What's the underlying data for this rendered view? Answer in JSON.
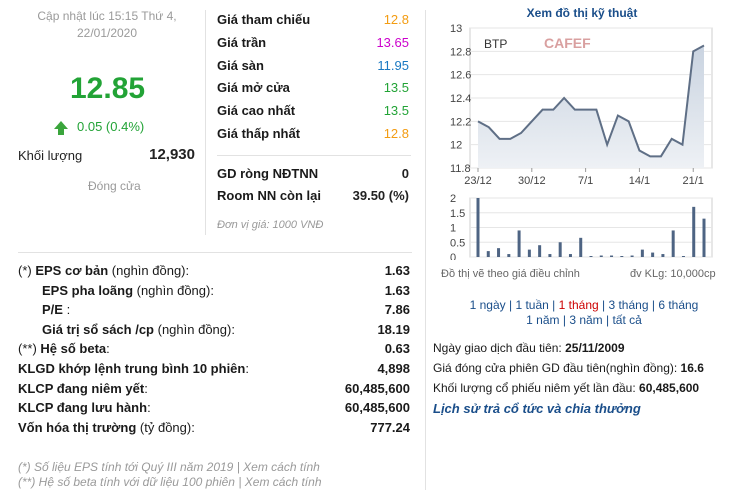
{
  "update": {
    "line1": "Cập nhật lúc 15:15 Thứ 4,",
    "line2": "22/01/2020"
  },
  "price": {
    "current": "12.85",
    "change": "0.05 (0.4%)",
    "volume_label": "Khối lượng",
    "volume_value": "12,930",
    "session_label": "Đóng cửa"
  },
  "colors": {
    "up": "#22a336",
    "ref": "#f39c12",
    "ceil": "#cc00cc",
    "floor": "#1a78c2",
    "link": "#1a4e8a",
    "active": "#cc0000"
  },
  "price_grid": [
    {
      "label": "Giá tham chiếu",
      "value": "12.8",
      "color": "#f39c12"
    },
    {
      "label": "Giá trần",
      "value": "13.65",
      "color": "#cc00cc"
    },
    {
      "label": "Giá sàn",
      "value": "11.95",
      "color": "#1a78c2"
    },
    {
      "label": "Giá mở cửa",
      "value": "13.5",
      "color": "#22a336"
    },
    {
      "label": "Giá cao nhất",
      "value": "13.5",
      "color": "#22a336"
    },
    {
      "label": "Giá thấp nhất",
      "value": "12.8",
      "color": "#f39c12"
    }
  ],
  "foreign": [
    {
      "label": "GD ròng NĐTNN",
      "value": "0"
    },
    {
      "label": "Room NN còn lại",
      "value": "39.50 (%)"
    }
  ],
  "unit_note": "Đơn vị giá: 1000 VNĐ",
  "indicators": [
    {
      "prefix": "(*)",
      "label_bold": "EPS cơ bản",
      "label_rest": " (nghìn đồng):",
      "value": "1.63"
    },
    {
      "prefix": "",
      "label_bold": "EPS pha loãng",
      "label_rest": " (nghìn đồng):",
      "value": "1.63"
    },
    {
      "prefix": "",
      "label_bold": "P/E",
      "label_rest": " :",
      "value": "7.86"
    },
    {
      "prefix": "",
      "label_bold": "Giá trị sổ sách /cp",
      "label_rest": " (nghìn đồng):",
      "value": "18.19"
    },
    {
      "prefix": "(**)",
      "label_bold": "Hệ số beta",
      "label_rest": ":",
      "value": "0.63"
    },
    {
      "prefix": "",
      "label_bold": "KLGD khớp lệnh trung bình 10 phiên",
      "label_rest": ":",
      "value": "4,898"
    },
    {
      "prefix": "",
      "label_bold": "KLCP đang niêm yết",
      "label_rest": ":",
      "value": "60,485,600"
    },
    {
      "prefix": "",
      "label_bold": "KLCP đang lưu hành",
      "label_rest": ":",
      "value": "60,485,600"
    },
    {
      "prefix": "",
      "label_bold": "Vốn hóa thị trường",
      "label_rest": " (tỷ đồng):",
      "value": "777.24"
    }
  ],
  "footnotes": [
    {
      "text": "(*) Số liệu EPS tính tới Quý III năm 2019 | ",
      "link": "Xem cách tính"
    },
    {
      "text": "(**) Hệ số beta tính với dữ liệu 100 phiên | ",
      "link": "Xem cách tính"
    }
  ],
  "chart": {
    "title": "Xem đồ thị kỹ thuật",
    "ticker": "BTP",
    "watermark": "CAFEF",
    "note": "Đồ thị vẽ theo giá điều chỉnh",
    "volume_unit": "đv KLg: 10,000cp",
    "periods": [
      "1 ngày",
      "1 tuần",
      "1 tháng",
      "3 tháng",
      "6 tháng",
      "1 năm",
      "3 năm",
      "tất cả"
    ],
    "active_period": "1 tháng"
  },
  "chart_data": {
    "type": "line",
    "price": {
      "values": [
        12.2,
        12.15,
        12.05,
        12.05,
        12.1,
        12.2,
        12.3,
        12.3,
        12.4,
        12.3,
        12.3,
        12.3,
        12.0,
        12.25,
        12.2,
        11.95,
        11.9,
        11.9,
        12.05,
        12.0,
        12.8,
        12.85
      ],
      "ylim": [
        11.8,
        13.0
      ],
      "yticks": [
        "13",
        "12.8",
        "12.6",
        "12.4",
        "12.2",
        "12",
        "11.8"
      ],
      "xticks": [
        "23/12",
        "30/12",
        "7/1",
        "14/1",
        "21/1"
      ],
      "xtick_index": [
        0,
        5,
        10,
        15,
        20
      ]
    },
    "volume": {
      "values": [
        2.0,
        0.2,
        0.3,
        0.1,
        0.9,
        0.25,
        0.4,
        0.1,
        0.5,
        0.1,
        0.65,
        0.02,
        0.05,
        0.05,
        0.02,
        0.05,
        0.25,
        0.15,
        0.1,
        0.9,
        0.02,
        1.7,
        1.3
      ],
      "ylim": [
        0,
        2
      ],
      "yticks": [
        "2",
        "1.5",
        "1",
        "0.5",
        "0"
      ]
    }
  },
  "listing": {
    "first_date_label": "Ngày giao dịch đầu tiên: ",
    "first_date": "25/11/2009",
    "first_price_label": "Giá đóng cửa phiên GD đầu tiên(nghìn đồng): ",
    "first_price": "16.6",
    "first_volume_label": "Khối lượng cổ phiếu niêm yết lần đầu: ",
    "first_volume": "60,485,600",
    "history_link": "Lịch sử trả cổ tức và chia thưởng"
  }
}
